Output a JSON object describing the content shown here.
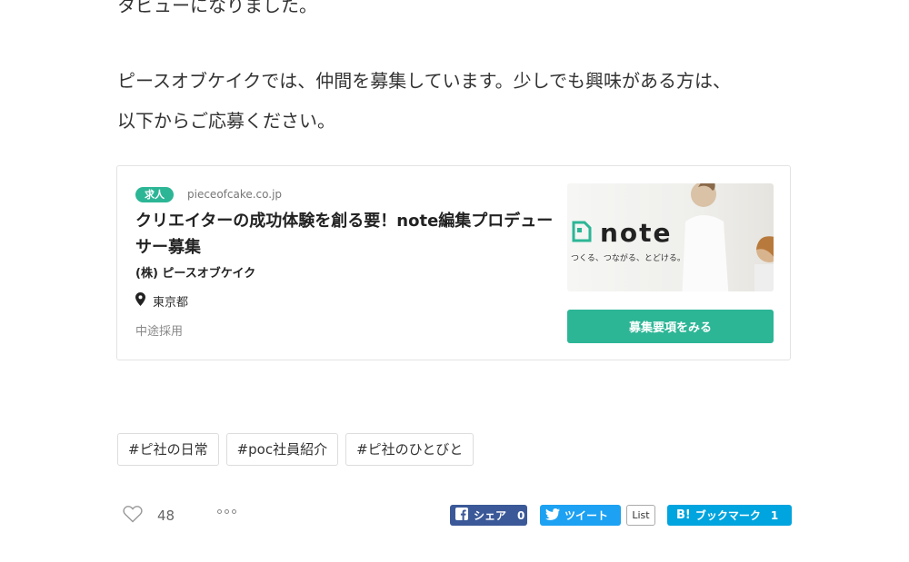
{
  "article": {
    "line1": "タビューになりました。",
    "line2": "ピースオブケイクでは、仲間を募集しています。少しでも興味がある方は、",
    "line3": "以下からご応募ください。"
  },
  "job_card": {
    "badge": "求人",
    "domain": "pieceofcake.co.jp",
    "title": "クリエイターの成功体験を創る要！note編集プロデューサー募集",
    "company": "(株) ピースオブケイク",
    "location": "東京都",
    "employment_type": "中途採用",
    "thumbnail": {
      "logo_text": "note",
      "tagline": "つくる、つながる、とどける。"
    },
    "apply_button": "募集要項をみる"
  },
  "tags": [
    "#ピ社の日常",
    "#poc社員紹介",
    "#ピ社のひとびと"
  ],
  "footer": {
    "like_count": "48",
    "facebook_label": "シェア",
    "facebook_count": "0",
    "twitter_label": "ツイート",
    "list_label": "List",
    "hatena_logo": "B!",
    "hatena_label": "ブックマーク",
    "hatena_count": "1"
  },
  "colors": {
    "accent": "#2cb696",
    "facebook": "#3b5998",
    "twitter": "#1da1f2",
    "hatena": "#00a4de"
  }
}
